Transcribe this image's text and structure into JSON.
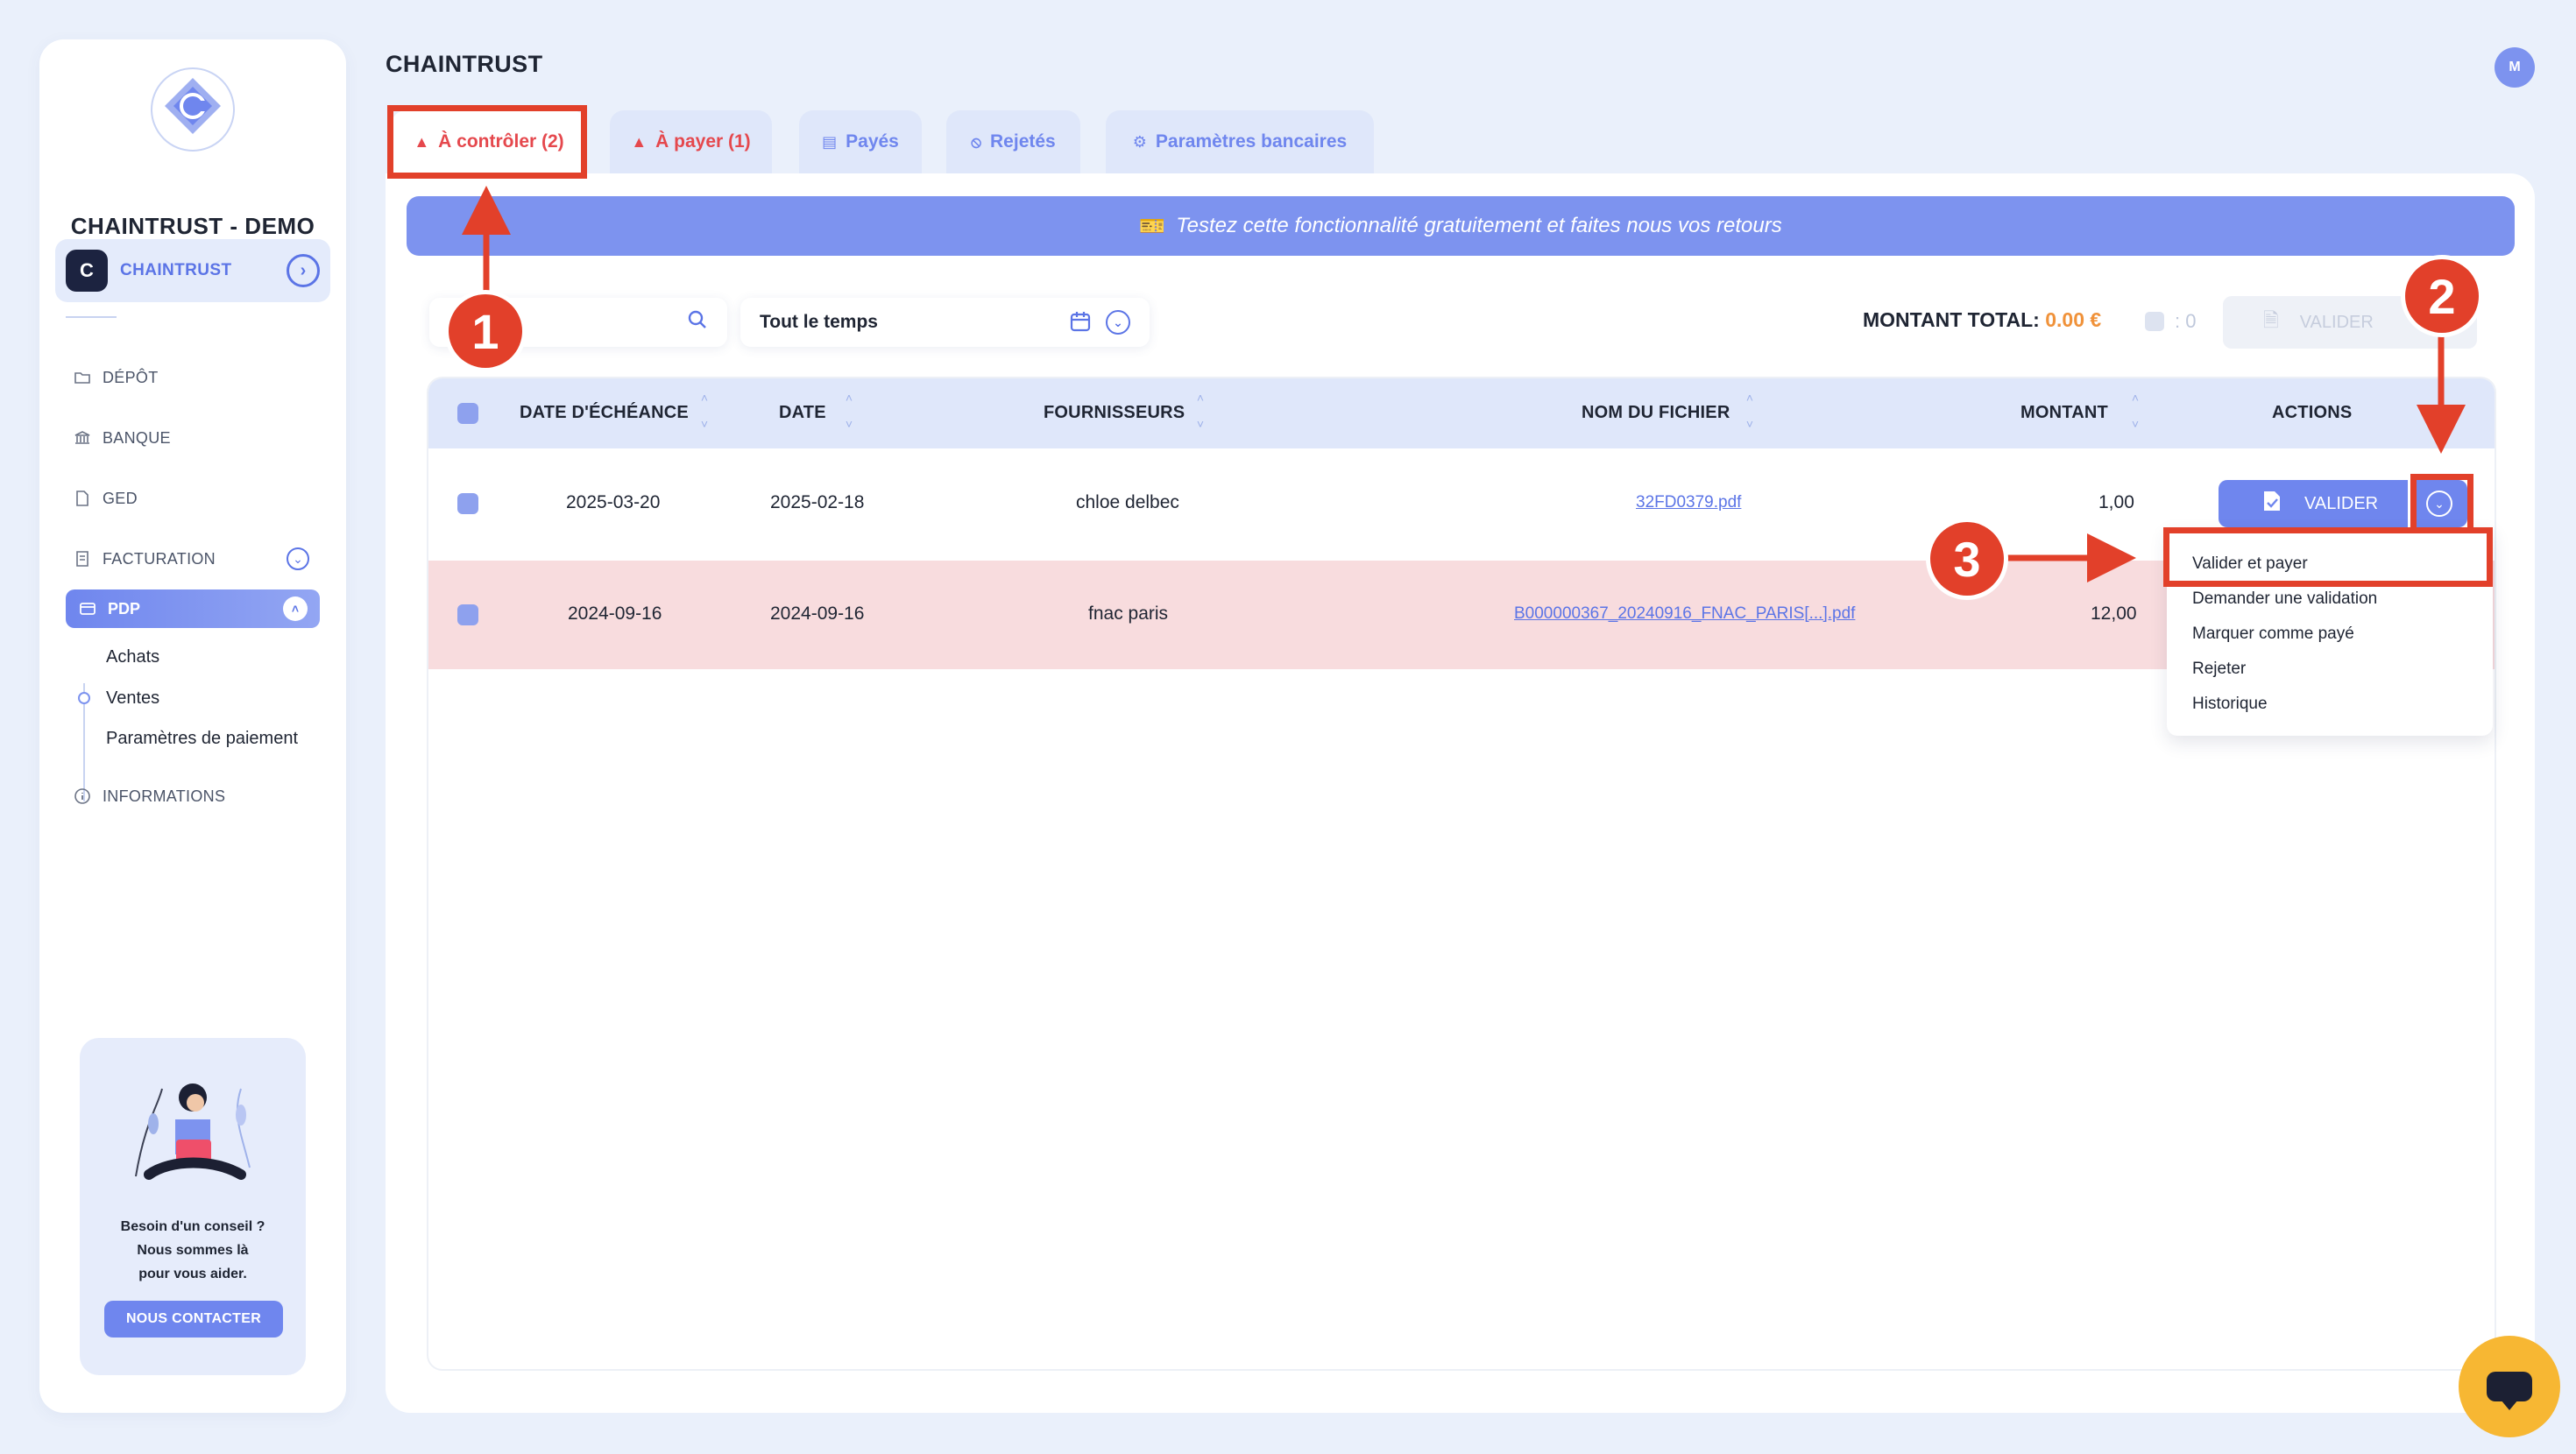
{
  "sidebar": {
    "org_name": "CHAINTRUST - DEMO",
    "workspace": "CHAINTRUST",
    "nav": {
      "depot": "DÉPÔT",
      "banque": "BANQUE",
      "ged": "GED",
      "facturation": "FACTURATION",
      "pdp": "PDP",
      "informations": "INFORMATIONS"
    },
    "pdp_sub": [
      "Achats",
      "Ventes",
      "Paramètres de paiement"
    ],
    "help": {
      "line1": "Besoin d'un conseil ?",
      "line2": "Nous sommes là",
      "line3": "pour vous aider.",
      "button": "NOUS CONTACTER"
    }
  },
  "header": {
    "title": "CHAINTRUST",
    "avatar_initial": "M"
  },
  "tabs": [
    {
      "label": "À contrôler (2)",
      "icon": "warning-icon",
      "active": true
    },
    {
      "label": "À payer (1)",
      "icon": "warning-icon",
      "active": false
    },
    {
      "label": "Payés",
      "icon": "card-icon",
      "active": false
    },
    {
      "label": "Rejetés",
      "icon": "ban-icon",
      "active": false
    },
    {
      "label": "Paramètres bancaires",
      "icon": "gear-icon",
      "active": false
    }
  ],
  "banner": {
    "text": "Testez cette fonctionnalité gratuitement et faites nous vos retours"
  },
  "filters": {
    "search_placeholder": "er",
    "period_value": "Tout le temps"
  },
  "summary": {
    "total_label": "MONTANT TOTAL:",
    "total_value": "0.00 €",
    "selected_count": ": 0",
    "validate_label": "VALIDER"
  },
  "table": {
    "columns": [
      "DATE D'ÉCHÉANCE",
      "DATE",
      "FOURNISSEURS",
      "NOM DU FICHIER",
      "MONTANT",
      "ACTIONS"
    ],
    "rows": [
      {
        "due_date": "2025-03-20",
        "date": "2025-02-18",
        "supplier": "chloe delbec",
        "file": "32FD0379.pdf",
        "amount": "1,00",
        "highlight": false
      },
      {
        "due_date": "2024-09-16",
        "date": "2024-09-16",
        "supplier": "fnac paris",
        "file": "B000000367_20240916_FNAC_PARIS[...].pdf",
        "amount": "12,00",
        "highlight": true
      }
    ],
    "row_action_label": "VALIDER"
  },
  "action_menu": [
    "Valider et payer",
    "Demander une validation",
    "Marquer comme payé",
    "Rejeter",
    "Historique"
  ],
  "annotations": {
    "step1": "1",
    "step2": "2",
    "step3": "3",
    "color": "#e2402a"
  },
  "colors": {
    "accent": "#6f86ee",
    "warning": "#e5484d",
    "total_amount": "#f0923a",
    "row_highlight": "#f8dcde"
  }
}
